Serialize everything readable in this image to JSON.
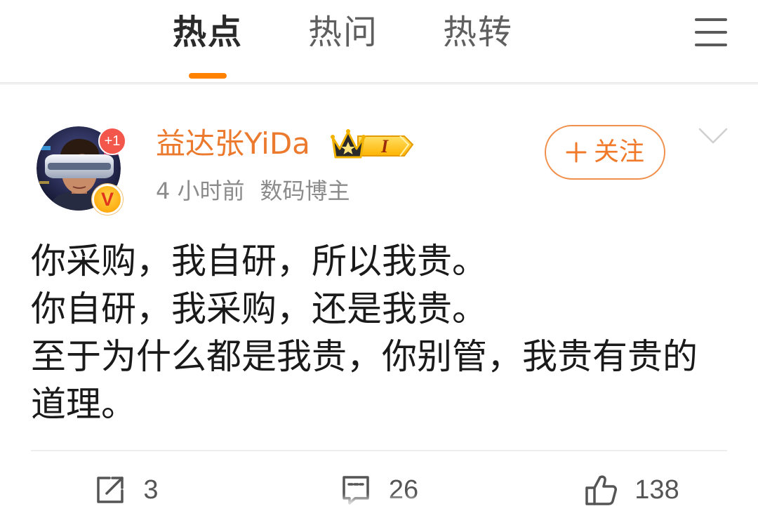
{
  "tabs": [
    {
      "label": "热点",
      "active": true
    },
    {
      "label": "热问",
      "active": false
    },
    {
      "label": "热转",
      "active": false
    }
  ],
  "icons": {
    "menu": "hamburger-menu-icon",
    "more": "chevron-down-icon",
    "follow": "plus-icon",
    "level": "crown-level-badge-icon",
    "share": "share-icon",
    "comment": "comment-icon",
    "like": "thumbs-up-icon"
  },
  "post": {
    "author": {
      "name": "益达张YiDa",
      "avatar_badge": "+1",
      "verified_badge": "V",
      "level_badge": "I"
    },
    "time": "4 小时前",
    "author_tag": "数码博主",
    "follow_label": "关注",
    "paragraphs": [
      "你采购，我自研，所以我贵。",
      "你自研，我采购，还是我贵。",
      "至于为什么都是我贵，你别管，我贵有贵的道理。"
    ]
  },
  "actions": {
    "share_count": "3",
    "comment_count": "26",
    "like_count": "138"
  },
  "colors": {
    "accent": "#ff8200",
    "name_color": "#ec7a2e",
    "follow_color": "#f07a2a",
    "meta_color": "#8b8b8b",
    "icon_color": "#555555"
  }
}
